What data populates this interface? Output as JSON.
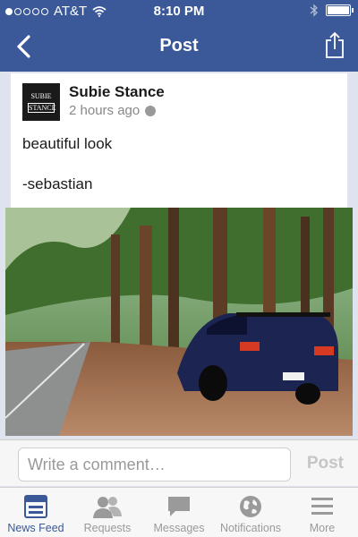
{
  "status_bar": {
    "carrier": "AT&T",
    "time": "8:10 PM"
  },
  "nav": {
    "title": "Post"
  },
  "post": {
    "author": "Subie Stance",
    "time_ago": "2 hours ago",
    "avatar_line1": "SUBIE",
    "avatar_line2": "STANCE",
    "lines": [
      "beautiful look",
      "-sebastian"
    ]
  },
  "comment": {
    "placeholder": "Write a comment…",
    "post_label": "Post"
  },
  "tabs": [
    {
      "label": "News Feed",
      "icon": "news-feed-icon",
      "active": true
    },
    {
      "label": "Requests",
      "icon": "friend-requests-icon",
      "active": false
    },
    {
      "label": "Messages",
      "icon": "messages-icon",
      "active": false
    },
    {
      "label": "Notifications",
      "icon": "globe-icon",
      "active": false
    },
    {
      "label": "More",
      "icon": "menu-icon",
      "active": false
    }
  ],
  "colors": {
    "brand": "#3b5998",
    "inactive_tab": "#9a9a9a"
  }
}
